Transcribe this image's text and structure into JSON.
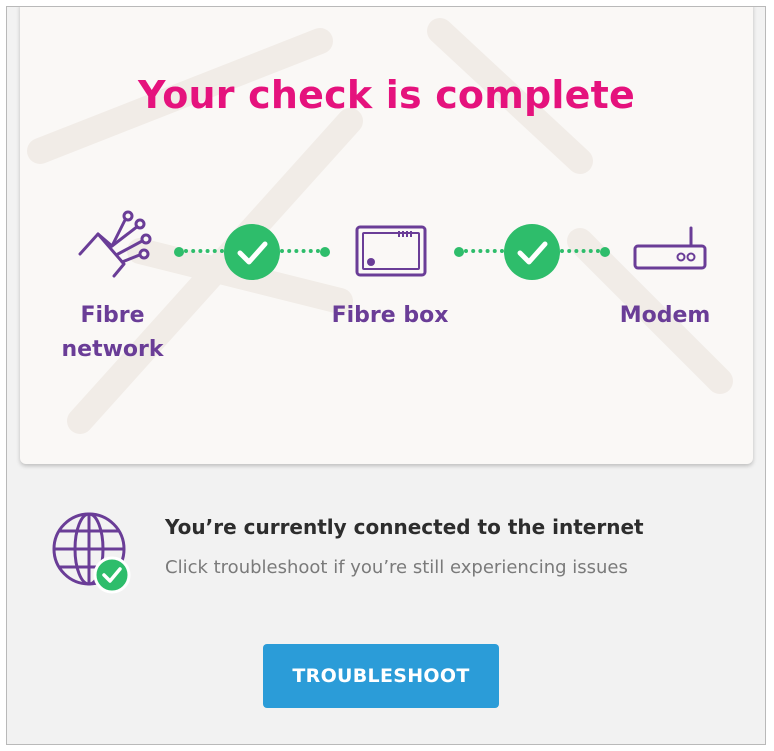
{
  "card": {
    "title": "Your check is complete",
    "nodes": [
      {
        "label_line1": "Fibre",
        "label_line2": "network",
        "icon": "fibre-network-icon"
      },
      {
        "label_line1": "Fibre box",
        "icon": "fibre-box-icon"
      },
      {
        "label_line1": "Modem",
        "icon": "modem-icon"
      }
    ],
    "links": [
      {
        "status": "ok",
        "icon": "check-icon"
      },
      {
        "status": "ok",
        "icon": "check-icon"
      }
    ]
  },
  "status": {
    "icon": "globe-icon",
    "badge_icon": "check-icon",
    "title": "You’re currently connected to the internet",
    "subtitle": "Click troubleshoot if you’re still experiencing issues"
  },
  "action": {
    "button_label": "TROUBLESHOOT"
  },
  "colors": {
    "title": "#e5127d",
    "node": "#6a3d97",
    "ok": "#2ebd6b",
    "button": "#2b9cd8"
  }
}
